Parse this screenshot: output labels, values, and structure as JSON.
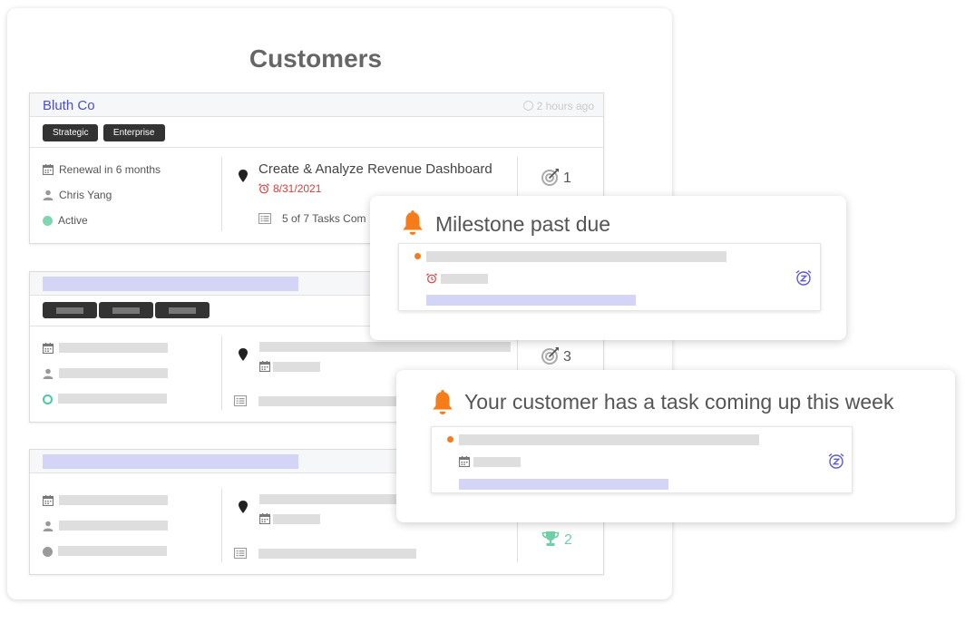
{
  "page": {
    "title": "Customers"
  },
  "customers": [
    {
      "name": "Bluth Co",
      "time": "2 hours ago",
      "tags": [
        "Strategic",
        "Enterprise"
      ],
      "renewal": "Renewal in 6 months",
      "owner": "Chris Yang",
      "status": "Active",
      "status_color": "#7fd6b3",
      "task_title": "Create & Analyze Revenue Dashboard",
      "due_date": "8/31/2021",
      "tasks_progress": "5 of 7 Tasks Com",
      "count": "1",
      "count_icon": "target-icon"
    },
    {
      "name": "",
      "count": "3",
      "count_icon": "target-icon",
      "status_color": "#4ec99e"
    },
    {
      "name": "",
      "count": "2",
      "count_icon": "trophy-icon",
      "status_color": "#9a9a9a"
    }
  ],
  "notifications": [
    {
      "title": "Milestone past due",
      "icon": "bell-icon",
      "date_icon": "alarm-icon",
      "action_icon": "snooze-icon"
    },
    {
      "title": "Your customer has a task coming up this week",
      "icon": "bell-icon",
      "date_icon": "calendar-icon",
      "action_icon": "snooze-icon"
    }
  ],
  "colors": {
    "accent": "#4a4bd6",
    "alert": "#f57c19",
    "overdue": "#e13b3b",
    "placeholder": "#d4d4f7",
    "success": "#6fcfa8"
  }
}
